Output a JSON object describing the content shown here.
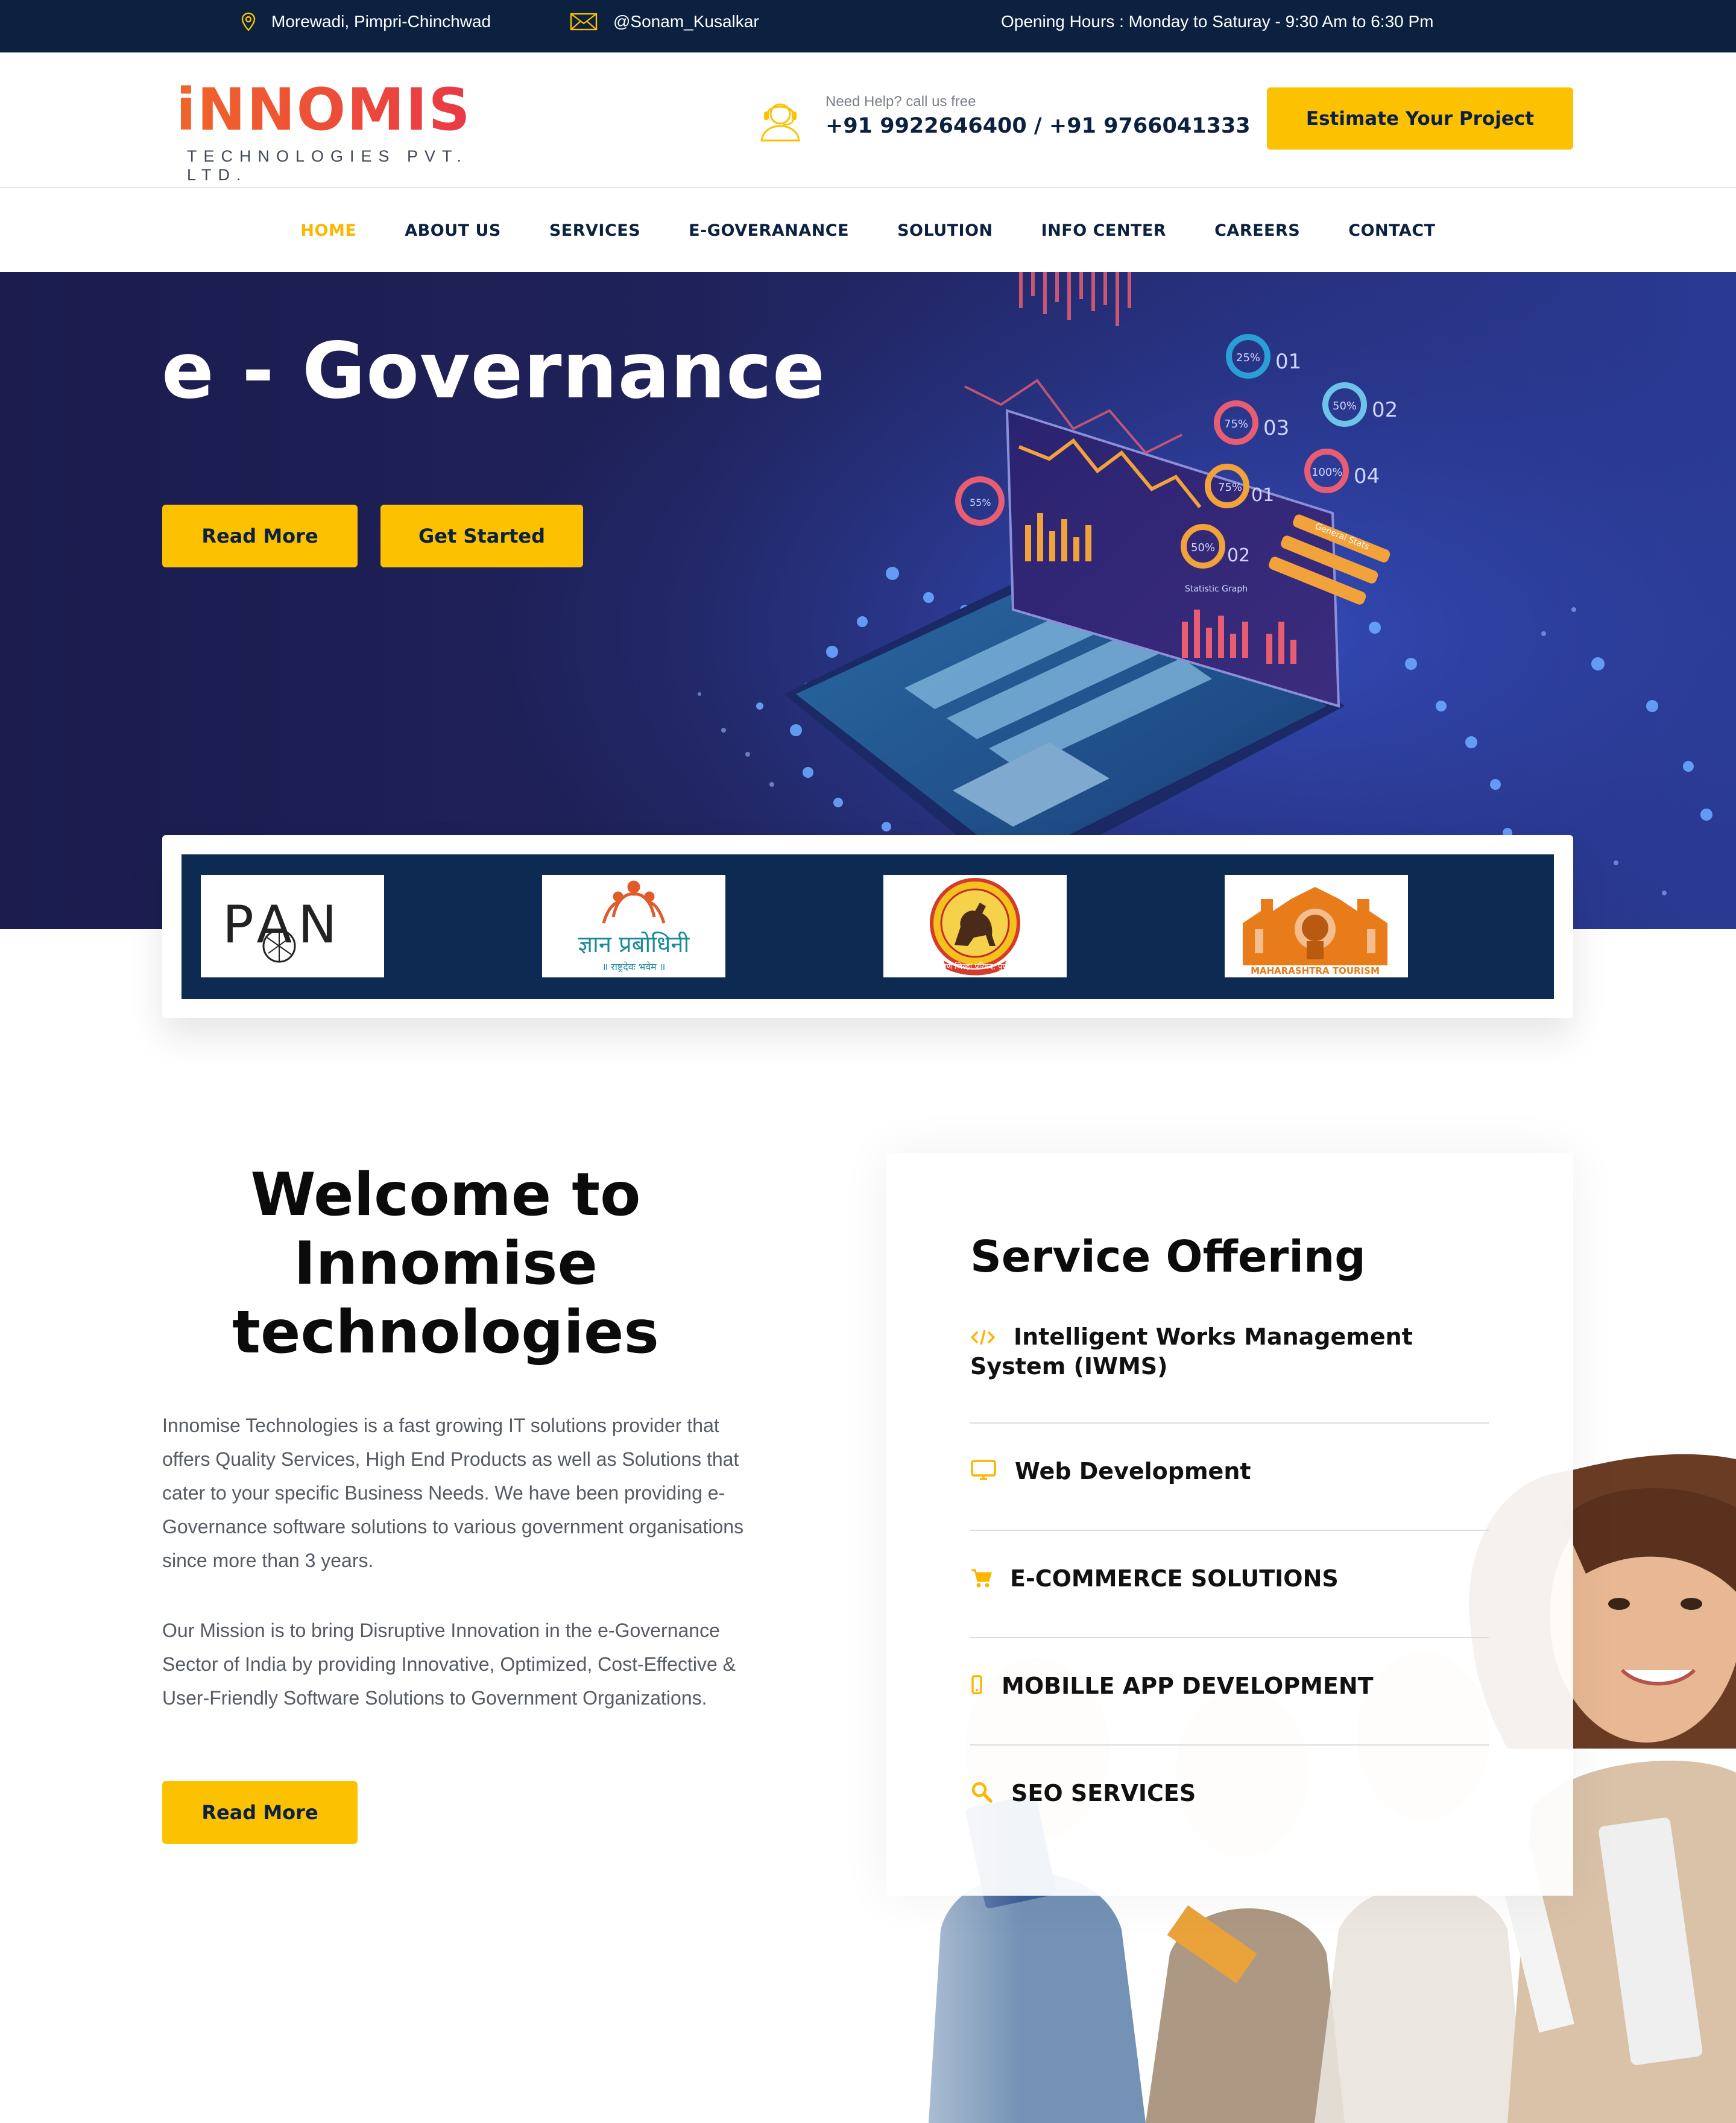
{
  "topbar": {
    "location": "Morewadi, Pimpri-Chinchwad",
    "handle": "@Sonam_Kusalkar",
    "hours": "Opening Hours : Monday to Saturay - 9:30 Am to 6:30 Pm"
  },
  "header": {
    "logo_word": "iNNOMISE",
    "logo_tagline": "TECHNOLOGIES PVT. LTD.",
    "help_label": "Need Help? call us free",
    "phones": "+91 9922646400 / +91 9766041333",
    "estimate_button": "Estimate Your Project"
  },
  "nav": {
    "items": [
      "HOME",
      "ABOUT US",
      "SERVICES",
      "E-GOVERANANCE",
      "SOLUTION",
      "INFO CENTER",
      "CAREERS",
      "CONTACT"
    ],
    "active": "HOME"
  },
  "hero": {
    "title": "e - Governance",
    "read_more": "Read More",
    "get_started": "Get Started",
    "art_labels": [
      "25%",
      "01",
      "50%",
      "02",
      "75%",
      "03",
      "100%",
      "04",
      "75%",
      "01",
      "50%",
      "02",
      "55%",
      "Statistic Graph",
      "General Stats"
    ]
  },
  "partners": {
    "pan": "PAN",
    "gyan_title": "ज्ञान प्रबोधिनी",
    "gyan_sub": "॥ राष्ट्रदेवः भवेम ॥",
    "zp_text": "पुणे जिल्हा परिषद, पुणे",
    "mh_tourism": "MAHARASHTRA TOURISM"
  },
  "welcome": {
    "title_lines": [
      "Welcome to",
      "Innomise",
      "technologies"
    ],
    "para1": "Innomise Technologies is a fast growing IT solutions provider that offers Quality Services, High End Products as well as Solutions that cater to your specific Business Needs. We have been providing e-Governance software solutions to various government organisations since more than 3 years.",
    "para2": "Our Mission is to bring Disruptive Innovation in the e-Governance Sector of India by providing Innovative, Optimized, Cost-Effective & User-Friendly Software Solutions to Government Organizations.",
    "read_more": "Read More"
  },
  "services": {
    "title": "Service Offering",
    "items": [
      {
        "label": "Intelligent Works Management System (IWMS)",
        "icon": "code-icon"
      },
      {
        "label": "Web Development",
        "icon": "monitor-icon"
      },
      {
        "label": "E-COMMERCE SOLUTIONS",
        "icon": "cart-icon"
      },
      {
        "label": "MOBILLE APP DEVELOPMENT",
        "icon": "mobile-icon"
      },
      {
        "label": "SEO SERVICES",
        "icon": "search-icon"
      }
    ]
  },
  "colors": {
    "accent": "#fcc100",
    "navy": "#0c2140",
    "brand_orange": "#ec4e2d"
  }
}
